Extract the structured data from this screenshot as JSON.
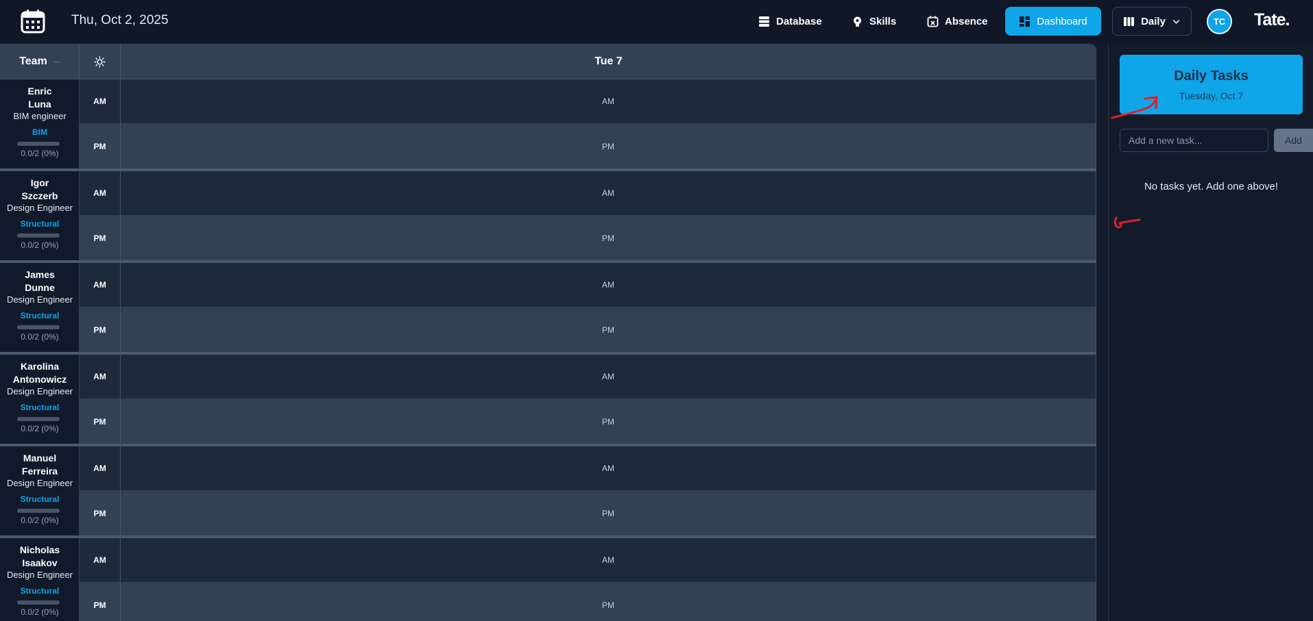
{
  "header": {
    "date": "Thu, Oct 2, 2025",
    "nav": {
      "database": "Database",
      "skills": "Skills",
      "absence": "Absence",
      "dashboard": "Dashboard",
      "view": "Daily"
    },
    "avatar_initials": "TC",
    "brand": "Tate."
  },
  "grid": {
    "team_header": "Team",
    "day_header": "Tue 7",
    "am_label": "AM",
    "pm_label": "PM",
    "members": [
      {
        "name": "Enric\nLuna",
        "role": "BIM engineer",
        "dept": "BIM",
        "util": "0.0/2 (0%)",
        "am": "AM",
        "pm": "PM"
      },
      {
        "name": "Igor\nSzczerb",
        "role": "Design Engineer",
        "dept": "Structural",
        "util": "0.0/2 (0%)",
        "am": "AM",
        "pm": "PM"
      },
      {
        "name": "James\nDunne",
        "role": "Design Engineer",
        "dept": "Structural",
        "util": "0.0/2 (0%)",
        "am": "AM",
        "pm": "PM"
      },
      {
        "name": "Karolina\nAntonowicz",
        "role": "Design Engineer",
        "dept": "Structural",
        "util": "0.0/2 (0%)",
        "am": "AM",
        "pm": "PM"
      },
      {
        "name": "Manuel\nFerreira",
        "role": "Design Engineer",
        "dept": "Structural",
        "util": "0.0/2 (0%)",
        "am": "AM",
        "pm": "PM"
      },
      {
        "name": "Nicholas\nIsaakov",
        "role": "Design Engineer",
        "dept": "Structural",
        "util": "0.0/2 (0%)",
        "am": "AM",
        "pm": "PM"
      }
    ]
  },
  "tasks": {
    "title": "Daily Tasks",
    "date": "Tuesday, Oct 7",
    "input_placeholder": "Add a new task...",
    "add_label": "Add",
    "empty_message": "No tasks yet. Add one above!"
  },
  "colors": {
    "accent": "#0ea5e9",
    "background": "#131b2b",
    "am_row": "#1e293b",
    "pm_row": "#334155",
    "annotation": "#e11d2a"
  },
  "icons": [
    "calendar-icon",
    "database-icon",
    "lightbulb-icon",
    "calendar-x-icon",
    "dashboard-icon",
    "columns-icon",
    "chevron-down-icon",
    "sun-icon"
  ]
}
